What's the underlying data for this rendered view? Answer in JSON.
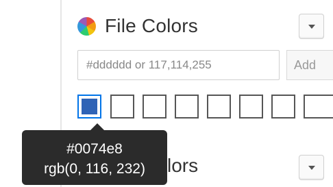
{
  "file_colors": {
    "title": "File Colors",
    "input_placeholder": "#dddddd or 117,114,255",
    "add_label": "Add",
    "swatches": [
      {
        "color": "#2f63b6",
        "selected": true
      },
      {
        "color": "",
        "selected": false
      },
      {
        "color": "",
        "selected": false
      },
      {
        "color": "",
        "selected": false
      },
      {
        "color": "",
        "selected": false
      },
      {
        "color": "",
        "selected": false
      },
      {
        "color": "",
        "selected": false
      },
      {
        "color": "",
        "selected": false
      },
      {
        "color": "",
        "selected": false
      }
    ]
  },
  "tooltip": {
    "hex": "#0074e8",
    "rgb": "rgb(0, 116, 232)"
  },
  "second_section": {
    "title_visible_part": "lors"
  },
  "colors": {
    "accent": "#0074e8",
    "tooltip_bg": "#2b2b2b",
    "border": "#cfcfcf"
  }
}
